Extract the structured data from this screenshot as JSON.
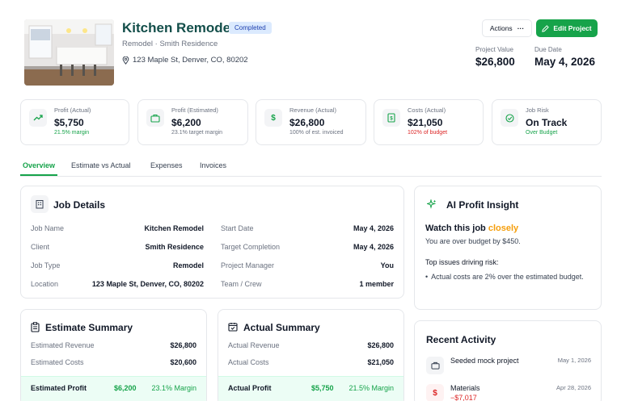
{
  "project": {
    "title": "Kitchen Remodel",
    "status": "Completed",
    "subtitle": "Remodel · Smith Residence",
    "address": "123 Maple St, Denver, CO, 80202",
    "actions_label": "Actions",
    "actions_more": "···",
    "edit_label": "Edit Project",
    "value_label": "Project Value",
    "value": "$26,800",
    "due_label": "Due Date",
    "due": "May 4, 2026"
  },
  "kpis": [
    {
      "label": "Profit (Actual)",
      "value": "$5,750",
      "sub": "21.5% margin",
      "icon": "trend-up-icon"
    },
    {
      "label": "Profit (Estimated)",
      "value": "$6,200",
      "sub": "23.1% target margin",
      "icon": "briefcase-icon"
    },
    {
      "label": "Revenue (Actual)",
      "value": "$26,800",
      "sub": "100% of est. invoiced",
      "icon": "dollar-icon"
    },
    {
      "label": "Costs (Actual)",
      "value": "$21,050",
      "sub": "102% of budget",
      "icon": "receipt-icon"
    },
    {
      "label": "Job Risk",
      "value": "On Track",
      "sub": "Over Budget",
      "icon": "check-circle-icon"
    }
  ],
  "tabs": [
    "Overview",
    "Estimate vs Actual",
    "Expenses",
    "Invoices"
  ],
  "job_details": {
    "title": "Job Details",
    "left": [
      {
        "label": "Job Name",
        "value": "Kitchen Remodel"
      },
      {
        "label": "Client",
        "value": "Smith Residence"
      },
      {
        "label": "Job Type",
        "value": "Remodel"
      },
      {
        "label": "Location",
        "value": "123 Maple St, Denver, CO, 80202"
      }
    ],
    "right": [
      {
        "label": "Start Date",
        "value": "May 4, 2026"
      },
      {
        "label": "Target Completion",
        "value": "May 4, 2026"
      },
      {
        "label": "Project Manager",
        "value": "You"
      },
      {
        "label": "Team / Crew",
        "value": "1 member"
      }
    ]
  },
  "estimate": {
    "title": "Estimate Summary",
    "rows": [
      {
        "label": "Estimated Revenue",
        "value": "$26,800"
      },
      {
        "label": "Estimated Costs",
        "value": "$20,600"
      }
    ],
    "footer_label": "Estimated Profit",
    "footer_value": "$6,200",
    "footer_margin": "23.1% Margin"
  },
  "actual": {
    "title": "Actual Summary",
    "rows": [
      {
        "label": "Actual Revenue",
        "value": "$26,800"
      },
      {
        "label": "Actual Costs",
        "value": "$21,050"
      }
    ],
    "footer_label": "Actual Profit",
    "footer_value": "$5,750",
    "footer_margin": "21.5% Margin"
  },
  "insight": {
    "title": "AI Profit Insight",
    "headline_prefix": "Watch this job",
    "headline_highlight": "closely",
    "detail": "You are over budget by $450.",
    "issues_title": "Top issues driving risk:",
    "issues": [
      "Actual costs are 2% over the estimated budget."
    ]
  },
  "activity": {
    "title": "Recent Activity",
    "items": [
      {
        "title": "Seeded mock project",
        "date": "May 1, 2026",
        "amount": "",
        "icon": "briefcase-icon"
      },
      {
        "title": "Materials",
        "date": "Apr 28, 2026",
        "amount": "−$7,017",
        "icon": "dollar-icon"
      }
    ]
  },
  "colors": {
    "brand_green": "#16a34a",
    "title_teal": "#134e4a",
    "danger": "#dc2626",
    "warning": "#f59e0b",
    "badge_bg": "#dbeafe",
    "badge_text": "#1e40af",
    "footer_bg": "#ecfdf5"
  }
}
